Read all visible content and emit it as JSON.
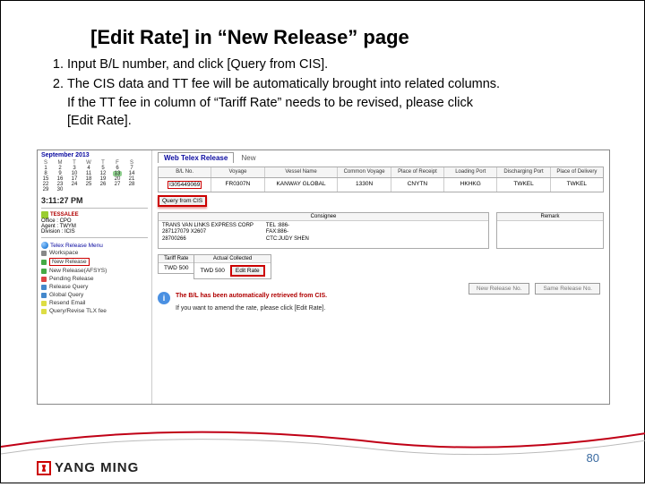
{
  "title": "[Edit Rate] in “New Release” page",
  "instructions": {
    "item1": "Input B/L number, and click [Query from CIS].",
    "item2": "The CIS data and TT fee will be automatically brought into related columns.",
    "item2b": "If the TT fee in column of “Tariff Rate” needs to be revised, please click",
    "item2c": "[Edit Rate]."
  },
  "sidebar": {
    "cal_month": "September 2013",
    "dow": [
      "S",
      "M",
      "T",
      "W",
      "T",
      "F",
      "S"
    ],
    "r1": [
      "1",
      "2",
      "3",
      "4",
      "5",
      "6",
      "7"
    ],
    "r2": [
      "8",
      "9",
      "10",
      "11",
      "12",
      "13",
      "14"
    ],
    "r3": [
      "15",
      "16",
      "17",
      "18",
      "19",
      "20",
      "21"
    ],
    "r4": [
      "22",
      "23",
      "24",
      "25",
      "26",
      "27",
      "28"
    ],
    "r5": [
      "29",
      "30",
      "",
      "",
      "",
      "",
      ""
    ],
    "time": "3:11:27 PM",
    "user": "TESSALEE",
    "office": "Office : CPO",
    "agent": "Agent : TWYM",
    "division": "Division : ICIS",
    "menu_title": "Telex Release Menu",
    "workspace": "Workspace",
    "new_release": "New Release",
    "new_release_af": "New Release(AFSYS)",
    "pending": "Pending Release",
    "rel_query": "Release Query",
    "global_query": "Global Query",
    "resend": "Resend Email",
    "query_rev": "Query/Revise TLX fee"
  },
  "tabs": {
    "active": "Web Telex Release",
    "tab2": "New"
  },
  "grid": {
    "h1": "B/L No.",
    "h2": "Voyage",
    "h3": "Vessel Name",
    "h4": "Common\nVoyage",
    "h5": "Place of\nReceipt",
    "h6": "Loading Port",
    "h7": "Discharging\nPort",
    "h8": "Place of\nDelivery",
    "c1": "I305449069",
    "c2": "FR0307N",
    "c3": "KANWAY GLOBAL",
    "c4": "1330N",
    "c5": "CNYTN",
    "c6": "HKHKG",
    "c7": "TWKEL",
    "c8": "TWKEL"
  },
  "query_btn": "Query from CIS",
  "consignee": {
    "head": "Consignee",
    "l1": "TRANS VAN LINKS EXPRESS CORP",
    "l2": "287127079 X2607",
    "l3": "28700266",
    "tel": "TEL :886-",
    "fax": "FAX:886-",
    "ctc": "CTC:JUDY SHEN"
  },
  "remark_head": "Remark",
  "rate": {
    "tariff_head": "Tariff Rate",
    "tariff_val": "TWD 500",
    "actual_head": "Actual Collected",
    "actual_val": "TWD 500",
    "edit": "Edit Rate"
  },
  "buttons": {
    "new": "New Release No.",
    "same": "Same Release No."
  },
  "info": {
    "main": "The B/L has been automatically retrieved from CIS.",
    "sub": "If you want to amend the rate, please click [Edit Rate]."
  },
  "logo_text": "YANG MING",
  "page_num": "80"
}
